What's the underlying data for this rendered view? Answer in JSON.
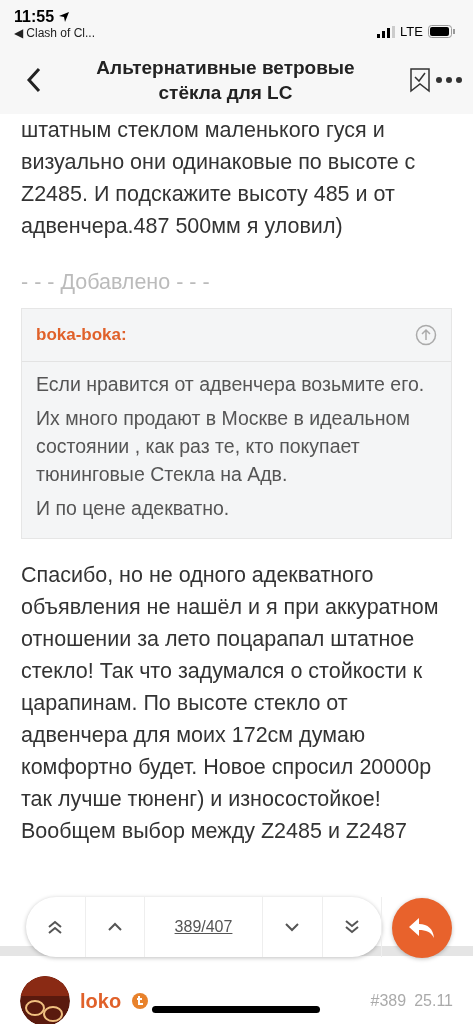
{
  "status_bar": {
    "time": "11:55",
    "back_app": "◀ Clash of Cl...",
    "network": "LTE"
  },
  "header": {
    "title": "Альтернативные ветровые стёкла для LC"
  },
  "post": {
    "text": "штатным стеклом маленького гуся и визуально они одинаковые по высоте с Z2485. И подскажите высоту 485 и от адвенчера.487 500мм я уловил)",
    "separator": "- - - Добавлено - - -",
    "quote": {
      "author": "boka-boka:",
      "paragraphs": [
        "Если нравится от адвенчера возьмите его.",
        "Их много продают в Москве в идеальном состоянии , как раз те, кто покупает тюнинговые Стекла на Адв.",
        "И по цене адекватно."
      ]
    },
    "reply": "Спасибо, но не одного адекватного объявления не нашёл и я при аккуратном отношении за лето поцарапал штатное стекло! Так что задумался о стойкости к царапинам. По высоте стекло от адвенчера для моих 172см думаю комфортно будет. Новое спросил 20000р так лучше тюненг) и износостойкое! Вообщем выбор между Z2485 и Z2487"
  },
  "navigator": {
    "position": "389/407"
  },
  "next_post": {
    "author": "loko",
    "number": "#389",
    "date": "25.11"
  }
}
